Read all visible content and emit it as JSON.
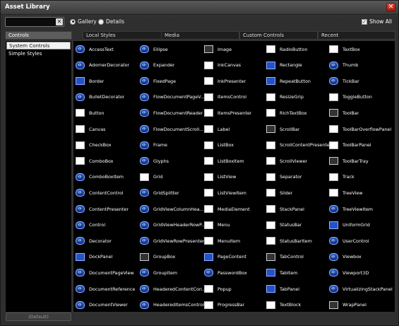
{
  "window": {
    "title": "Asset Library",
    "close_glyph": "✕"
  },
  "search": {
    "value": "",
    "clear_glyph": "✕"
  },
  "view_modes": [
    {
      "label": "Gallery",
      "selected": true
    },
    {
      "label": "Details",
      "selected": false
    }
  ],
  "show_all": {
    "label": "Show All",
    "checked": true
  },
  "tabs": [
    "Controls",
    "Local Styles",
    "Media",
    "Custom Controls",
    "Recent"
  ],
  "categories": [
    "System Controls",
    "Simple Styles"
  ],
  "default_button": "(Default)",
  "assets": [
    [
      "AccessText",
      "Ellipse",
      "Image",
      "RadioButton",
      "TextBox"
    ],
    [
      "AdornerDecorator",
      "Expander",
      "InkCanvas",
      "Rectangle",
      "Thumb"
    ],
    [
      "Border",
      "FixedPage",
      "InkPresenter",
      "RepeatButton",
      "TickBar"
    ],
    [
      "BulletDecorator",
      "FlowDocumentPageV...",
      "ItemsControl",
      "ResizeGrip",
      "ToggleButton"
    ],
    [
      "Button",
      "FlowDocumentReader",
      "ItemsPresenter",
      "RichTextBox",
      "ToolBar"
    ],
    [
      "Canvas",
      "FlowDocumentScroll...",
      "Label",
      "ScrollBar",
      "ToolBarOverflowPanel"
    ],
    [
      "CheckBox",
      "Frame",
      "ListBox",
      "ScrollContentPresenter",
      "ToolBarPanel"
    ],
    [
      "ComboBox",
      "Glyphs",
      "ListBoxItem",
      "ScrollViewer",
      "ToolBarTray"
    ],
    [
      "ComboBoxItem",
      "Grid",
      "ListView",
      "Separator",
      "Track"
    ],
    [
      "ContentControl",
      "GridSplitter",
      "ListViewItem",
      "Slider",
      "TreeView"
    ],
    [
      "ContentPresenter",
      "GridViewColumnHea...",
      "MediaElement",
      "StackPanel",
      "TreeViewItem"
    ],
    [
      "Control",
      "GridViewHeaderRowP...",
      "Menu",
      "StatusBar",
      "UniformGrid"
    ],
    [
      "Decorator",
      "GridViewRowPresenter",
      "MenuItem",
      "StatusBarItem",
      "UserControl"
    ],
    [
      "DockPanel",
      "GroupBox",
      "PageContent",
      "TabControl",
      "Viewbox"
    ],
    [
      "DocumentPageView",
      "GroupItem",
      "PasswordBox",
      "TabItem",
      "Viewport3D"
    ],
    [
      "DocumentReference",
      "HeaderedContentCon...",
      "Popup",
      "TabPanel",
      "VirtualizingStackPanel"
    ],
    [
      "DocumentViewer",
      "HeaderedItemsControl",
      "ProgressBar",
      "TextBlock",
      "WrapPanel"
    ]
  ]
}
